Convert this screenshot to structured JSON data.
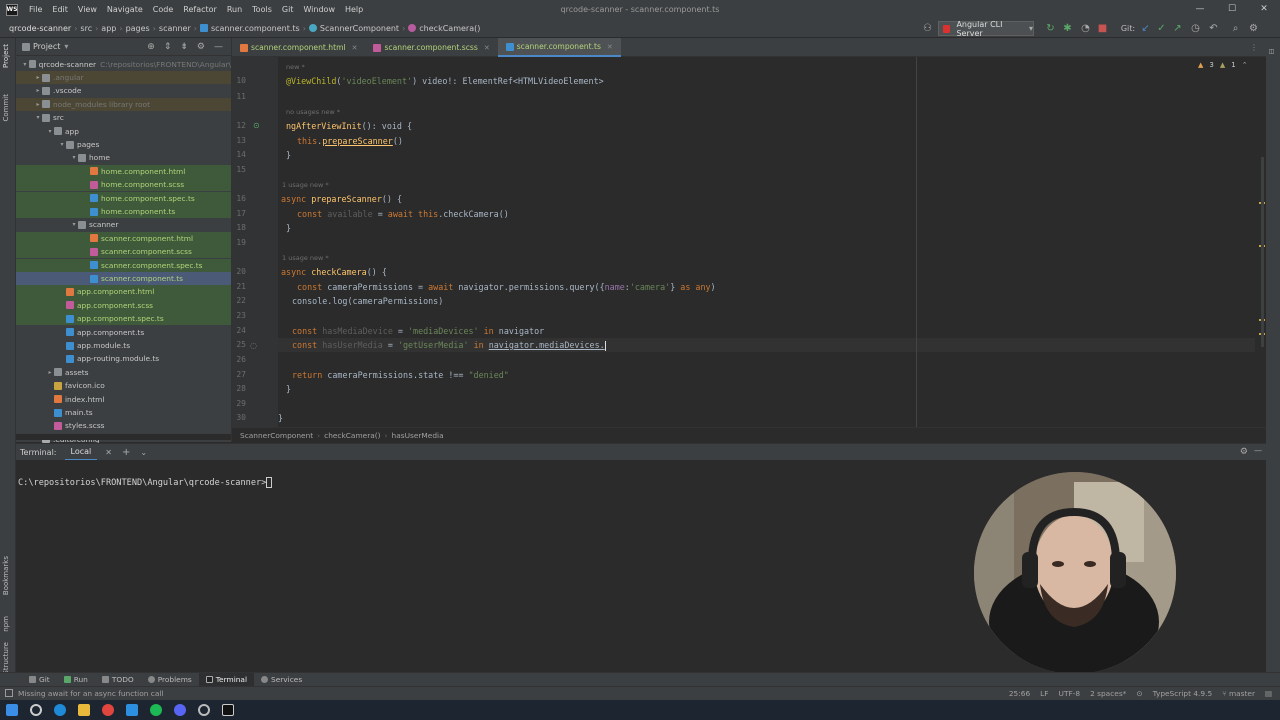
{
  "window": {
    "title": "qrcode-scanner - scanner.component.ts",
    "menu": [
      "File",
      "Edit",
      "View",
      "Navigate",
      "Code",
      "Refactor",
      "Run",
      "Tools",
      "Git",
      "Window",
      "Help"
    ]
  },
  "navbar": {
    "crumbs": [
      "qrcode-scanner",
      "src",
      "app",
      "pages",
      "scanner",
      "scanner.component.ts",
      "ScannerComponent",
      "checkCamera()"
    ],
    "run_config": "Angular CLI Server",
    "git_label": "Git:"
  },
  "project": {
    "title": "Project",
    "tree": [
      {
        "label": "qrcode-scanner",
        "hint": "C:\\repositorios\\FRONTEND\\Angular\\",
        "depth": 0,
        "arrow": "▾",
        "icon": "folder",
        "state": ""
      },
      {
        "label": ".angular",
        "depth": 1,
        "arrow": "▸",
        "icon": "folder",
        "state": "excl"
      },
      {
        "label": ".vscode",
        "depth": 1,
        "arrow": "▸",
        "icon": "folder",
        "state": ""
      },
      {
        "label": "node_modules  library root",
        "depth": 1,
        "arrow": "▸",
        "icon": "folder",
        "state": "excl"
      },
      {
        "label": "src",
        "depth": 1,
        "arrow": "▾",
        "icon": "folder",
        "state": ""
      },
      {
        "label": "app",
        "depth": 2,
        "arrow": "▾",
        "icon": "folder",
        "state": ""
      },
      {
        "label": "pages",
        "depth": 3,
        "arrow": "▾",
        "icon": "folder",
        "state": ""
      },
      {
        "label": "home",
        "depth": 4,
        "arrow": "▾",
        "icon": "folder",
        "state": ""
      },
      {
        "label": "home.component.html",
        "depth": 5,
        "arrow": "",
        "icon": "html",
        "state": "mod"
      },
      {
        "label": "home.component.scss",
        "depth": 5,
        "arrow": "",
        "icon": "scss",
        "state": "mod"
      },
      {
        "label": "home.component.spec.ts",
        "depth": 5,
        "arrow": "",
        "icon": "ts",
        "state": "mod"
      },
      {
        "label": "home.component.ts",
        "depth": 5,
        "arrow": "",
        "icon": "ts",
        "state": "mod"
      },
      {
        "label": "scanner",
        "depth": 4,
        "arrow": "▾",
        "icon": "folder",
        "state": ""
      },
      {
        "label": "scanner.component.html",
        "depth": 5,
        "arrow": "",
        "icon": "html",
        "state": "mod"
      },
      {
        "label": "scanner.component.scss",
        "depth": 5,
        "arrow": "",
        "icon": "scss",
        "state": "mod"
      },
      {
        "label": "scanner.component.spec.ts",
        "depth": 5,
        "arrow": "",
        "icon": "ts",
        "state": "mod"
      },
      {
        "label": "scanner.component.ts",
        "depth": 5,
        "arrow": "",
        "icon": "ts",
        "state": "sel"
      },
      {
        "label": "app.component.html",
        "depth": 3,
        "arrow": "",
        "icon": "html",
        "state": "mod"
      },
      {
        "label": "app.component.scss",
        "depth": 3,
        "arrow": "",
        "icon": "scss",
        "state": "mod"
      },
      {
        "label": "app.component.spec.ts",
        "depth": 3,
        "arrow": "",
        "icon": "ts",
        "state": "mod"
      },
      {
        "label": "app.component.ts",
        "depth": 3,
        "arrow": "",
        "icon": "ts",
        "state": ""
      },
      {
        "label": "app.module.ts",
        "depth": 3,
        "arrow": "",
        "icon": "ts",
        "state": ""
      },
      {
        "label": "app-routing.module.ts",
        "depth": 3,
        "arrow": "",
        "icon": "ts",
        "state": ""
      },
      {
        "label": "assets",
        "depth": 2,
        "arrow": "▸",
        "icon": "folder",
        "state": ""
      },
      {
        "label": "favicon.ico",
        "depth": 2,
        "arrow": "",
        "icon": "ico",
        "state": ""
      },
      {
        "label": "index.html",
        "depth": 2,
        "arrow": "",
        "icon": "html",
        "state": ""
      },
      {
        "label": "main.ts",
        "depth": 2,
        "arrow": "",
        "icon": "ts",
        "state": ""
      },
      {
        "label": "styles.scss",
        "depth": 2,
        "arrow": "",
        "icon": "scss",
        "state": ""
      },
      {
        "label": ".editorconfig",
        "depth": 1,
        "arrow": "",
        "icon": "json",
        "state": ""
      }
    ]
  },
  "editor": {
    "tabs": [
      {
        "label": "scanner.component.html",
        "icon": "html",
        "active": false
      },
      {
        "label": "scanner.component.scss",
        "icon": "scss",
        "active": false
      },
      {
        "label": "scanner.component.ts",
        "icon": "ts",
        "active": true
      }
    ],
    "inspection": {
      "warnings": "3",
      "weak": "1"
    },
    "line_numbers": [
      "10",
      "11",
      "12",
      "13",
      "14",
      "15",
      "16",
      "17",
      "18",
      "19",
      "20",
      "21",
      "22",
      "23",
      "24",
      "25",
      "26",
      "27",
      "28",
      "29",
      "30"
    ],
    "hints": {
      "h10": "new *",
      "h12": "no usages   new *",
      "h16": "1 usage   new *",
      "h20": "1 usage   new *"
    },
    "breadcrumb": [
      "ScannerComponent",
      "checkCamera()",
      "hasUserMedia"
    ]
  },
  "code": {
    "l10_ann": "@ViewChild",
    "l10_a": "(",
    "l10_str": "'videoElement'",
    "l10_b": ") video!: ElementRef<HTMLVideoElement>",
    "l12_fn": "ngAfterViewInit",
    "l12_b": "(): void {",
    "l13_kw": "this",
    "l13_b": ".",
    "l13_fn": "prepareScanner",
    "l13_c": "()",
    "l14": "}",
    "l16_kw": "async",
    "l16_fn": "prepareScanner",
    "l16_b": "() {",
    "l17_kw": "const",
    "l17_un": "available",
    "l17_b": "=",
    "l17_kw2": "await this",
    "l17_c": ".checkCamera()",
    "l18": "}",
    "l20_kw": "async",
    "l20_fn": "checkCamera",
    "l20_b": "() {",
    "l21_kw": "const",
    "l21_b": "cameraPermissions =",
    "l21_kw2": "await",
    "l21_c": "navigator.permissions.query({",
    "l21_prop": "name",
    "l21_d": ":",
    "l21_str": "'camera'",
    "l21_e": "}",
    "l21_kw3": "as any",
    "l21_f": ")",
    "l22": "console.log(cameraPermissions)",
    "l24_kw": "const",
    "l24_un": "hasMediaDevice",
    "l24_b": "=",
    "l24_str": "'mediaDevices'",
    "l24_kw2": "in",
    "l24_c": "navigator",
    "l25_kw": "const",
    "l25_un": "hasUserMedia",
    "l25_b": "=",
    "l25_str": "'getUserMedia'",
    "l25_kw2": "in",
    "l25_c": "navigator.mediaDevices.",
    "l27_kw": "return",
    "l27_b": "cameraPermissions.state !==",
    "l27_str": "\"denied\"",
    "l28": "}",
    "l30": "}"
  },
  "terminal": {
    "title": "Terminal:",
    "tab": "Local",
    "prompt": "C:\\repositorios\\FRONTEND\\Angular\\qrcode-scanner>"
  },
  "tooltabs": [
    "Git",
    "Run",
    "TODO",
    "Problems",
    "Terminal",
    "Services"
  ],
  "vertical_tabs": [
    "Project",
    "Commit",
    "Bookmarks",
    "npm",
    "Structure"
  ],
  "status": {
    "message": "Missing await for an async function call",
    "position": "25:66",
    "line_sep": "LF",
    "encoding": "UTF-8",
    "indent": "2 spaces*",
    "language": "TypeScript 4.9.5",
    "branch": "master"
  },
  "colors": {
    "bg": "#2b2b2b",
    "panel": "#3c3f41",
    "keyword": "#cc7832",
    "function": "#ffc66d",
    "string": "#6a8759",
    "annotation": "#bbb529",
    "modified": "#b3d47a"
  }
}
